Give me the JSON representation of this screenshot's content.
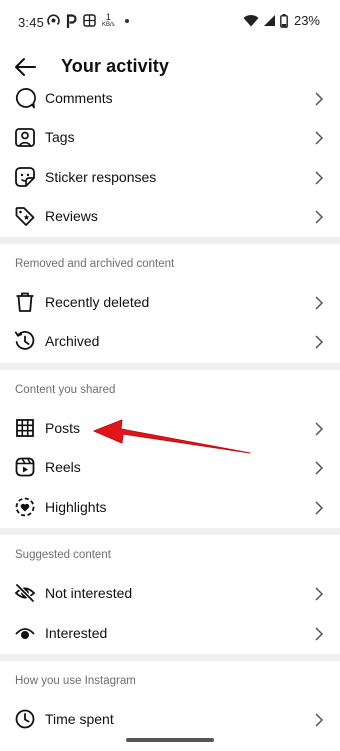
{
  "status_bar": {
    "time": "3:45",
    "net_speed_value": "1",
    "net_speed_unit": "KB/s",
    "battery": "23%"
  },
  "header": {
    "title": "Your activity"
  },
  "items": {
    "comments": "Comments",
    "tags": "Tags",
    "sticker_responses": "Sticker responses",
    "reviews": "Reviews",
    "recently_deleted": "Recently deleted",
    "archived": "Archived",
    "posts": "Posts",
    "reels": "Reels",
    "highlights": "Highlights",
    "not_interested": "Not interested",
    "interested": "Interested",
    "time_spent": "Time spent"
  },
  "sections": {
    "removed_archived": "Removed and archived content",
    "content_shared": "Content you shared",
    "suggested": "Suggested content",
    "how_you_use": "How you use Instagram"
  },
  "colors": {
    "annotation_arrow": "#e0161b",
    "divider": "#efefef",
    "section_text": "#6f6f6f"
  }
}
